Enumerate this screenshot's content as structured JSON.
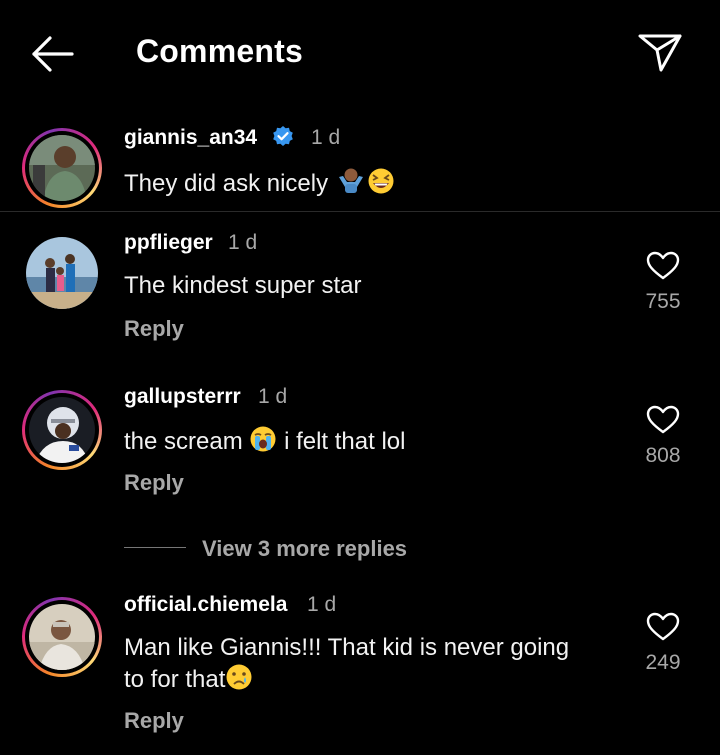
{
  "header": {
    "title": "Comments",
    "back_icon": "arrow-left-icon",
    "send_icon": "paper-plane-icon"
  },
  "caption": {
    "username": "giannis_an34",
    "verified": true,
    "time": "1 d",
    "text": "They did ask nicely",
    "emojis": [
      "person-shrugging-emoji",
      "grinning-squinting-face-emoji"
    ]
  },
  "comments": [
    {
      "username": "ppflieger",
      "time": "1 d",
      "text": "The kindest super star",
      "likes": "755",
      "reply": "Reply"
    },
    {
      "username": "gallupsterrr",
      "time": "1 d",
      "text_before": "the scream",
      "emoji": "loudly-crying-face-emoji",
      "text_after": "i felt that lol",
      "likes": "808",
      "reply": "Reply"
    },
    {
      "username": "official.chiemela",
      "time": "1 d",
      "text_line1": "Man like Giannis!!! That kid is never going",
      "text_line2": "to for that",
      "emoji": "crying-face-emoji",
      "likes": "249",
      "reply": "Reply"
    }
  ],
  "view_more": "View 3 more replies",
  "colors": {
    "background": "#000000",
    "secondary_text": "#a8a8a8",
    "verified_blue": "#3897f0"
  }
}
